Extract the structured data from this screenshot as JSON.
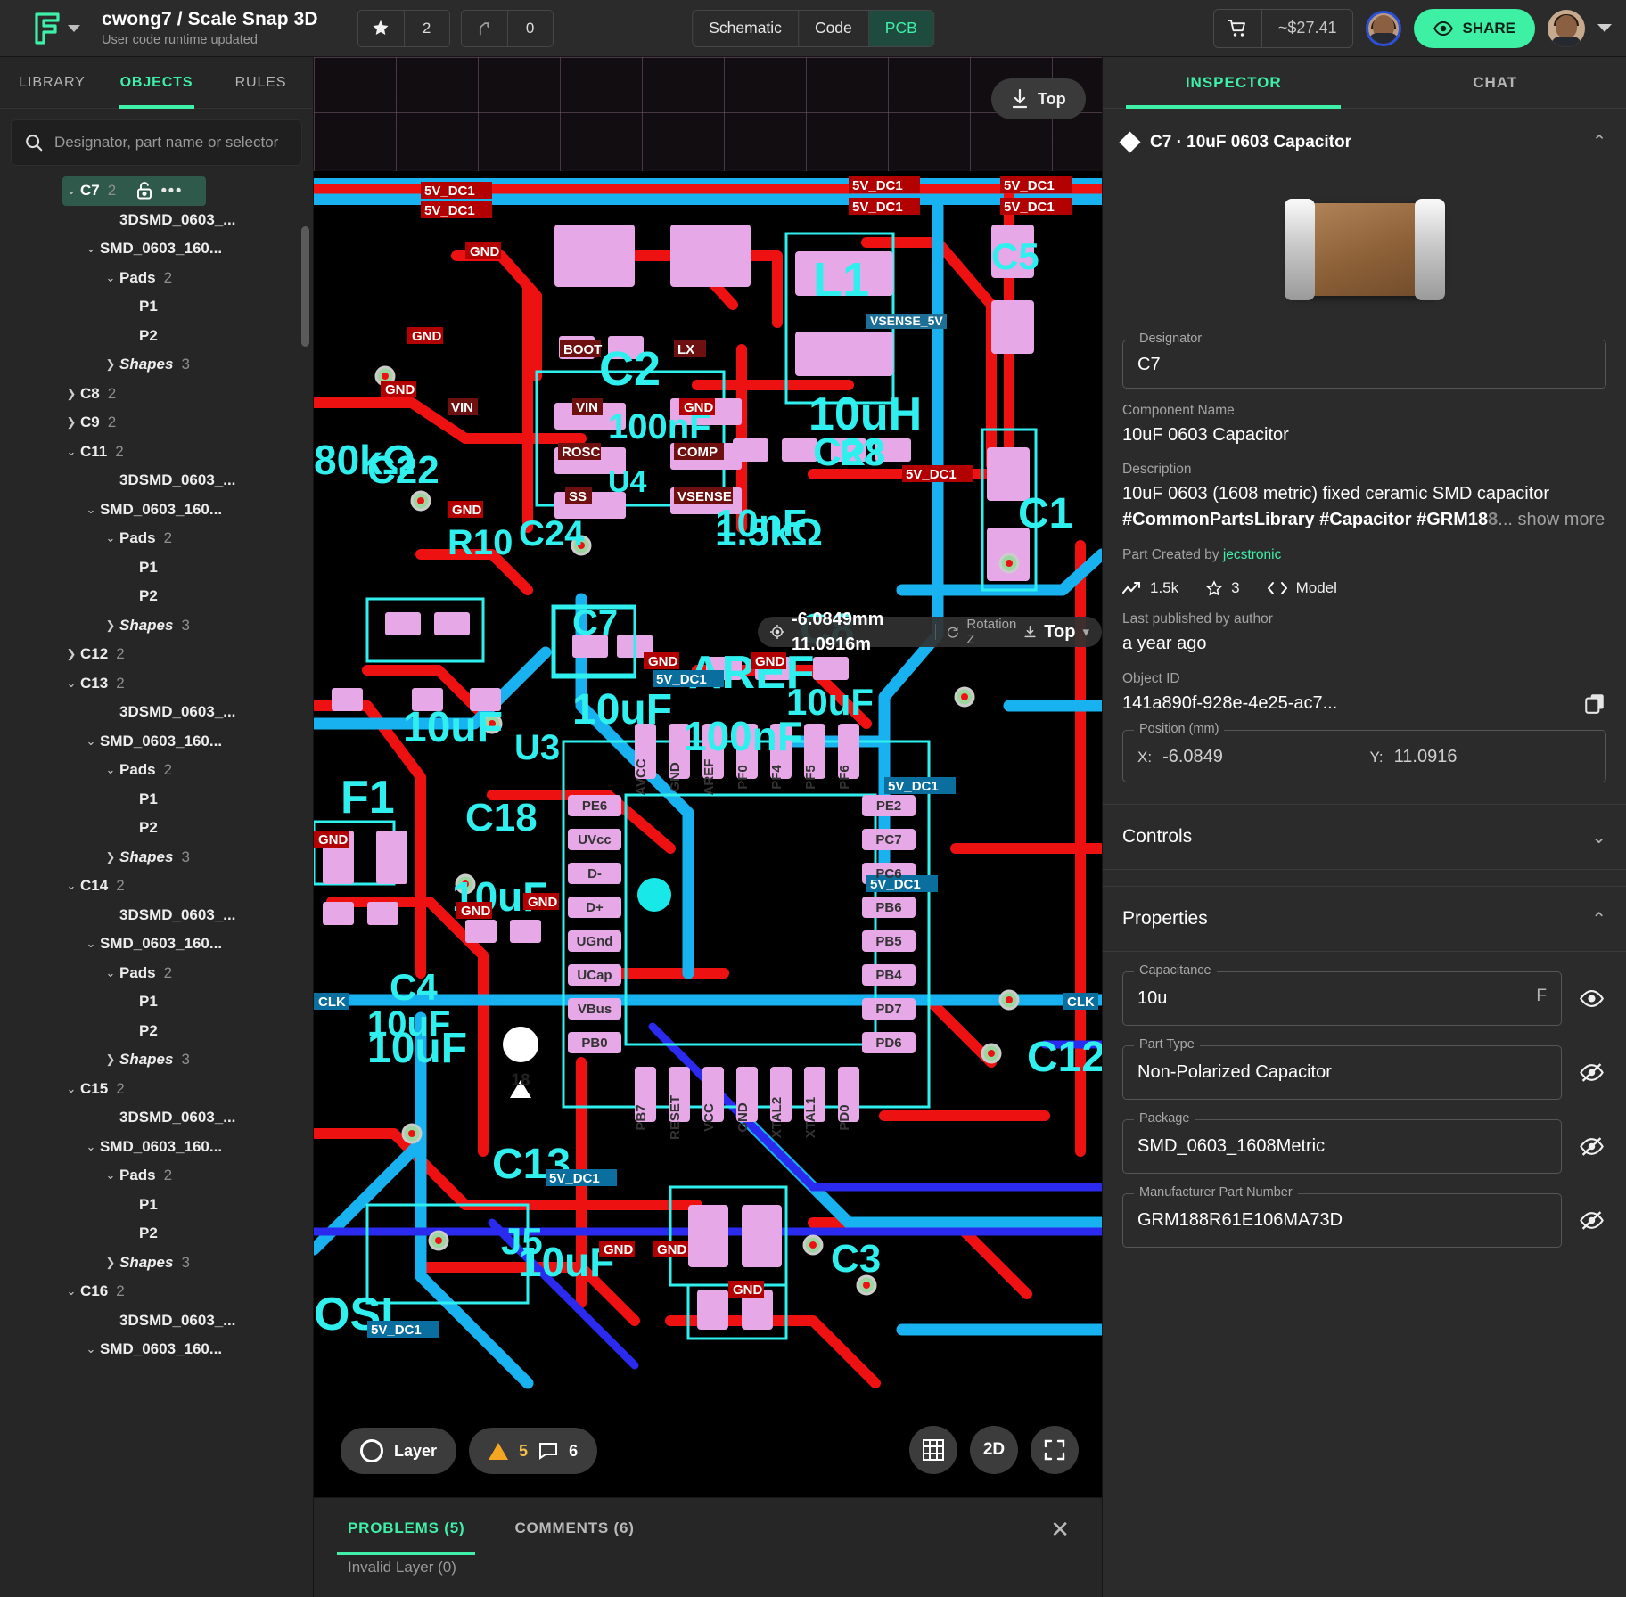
{
  "header": {
    "logo_icon": "flux-logo-icon",
    "project_owner_title": "cwong7 / Scale Snap 3D",
    "project_subtitle": "User code runtime updated",
    "star_icon": "star-icon",
    "star_count": "2",
    "fork_icon": "fork-icon",
    "fork_count": "0",
    "tabs": [
      {
        "label": "Schematic",
        "active": false
      },
      {
        "label": "Code",
        "active": false
      },
      {
        "label": "PCB",
        "active": true
      }
    ],
    "cart_icon": "shopping-cart-icon",
    "cart_price": "~$27.41",
    "collaborator_avatar": "collaborator-avatar",
    "share_icon": "eye-icon",
    "share_label": "SHARE",
    "user_avatar": "user-avatar",
    "user_caret_icon": "chevron-down-icon"
  },
  "left_panel": {
    "tabs": [
      {
        "label": "LIBRARY",
        "active": false
      },
      {
        "label": "OBJECTS",
        "active": true
      },
      {
        "label": "RULES",
        "active": false
      }
    ],
    "search": {
      "icon": "search-icon",
      "placeholder": "Designator, part name or selector",
      "value": ""
    },
    "tree": [
      {
        "indent": 1,
        "chev": "down",
        "label": "C7",
        "count": "2",
        "selected": true,
        "lock_icon": "unlock-icon",
        "more_icon": "more-horizontal-icon"
      },
      {
        "indent": 3,
        "chev": "none",
        "label": "3DSMD_0603_...",
        "count": ""
      },
      {
        "indent": 2,
        "chev": "down",
        "label": "SMD_0603_160...",
        "count": ""
      },
      {
        "indent": 3,
        "chev": "down",
        "label": "Pads",
        "count": "2"
      },
      {
        "indent": 4,
        "chev": "none",
        "label": "P1",
        "count": ""
      },
      {
        "indent": 4,
        "chev": "none",
        "label": "P2",
        "count": ""
      },
      {
        "indent": 3,
        "chev": "right",
        "label": "Shapes",
        "count": "3",
        "italic": true
      },
      {
        "indent": 1,
        "chev": "right",
        "label": "C8",
        "count": "2"
      },
      {
        "indent": 1,
        "chev": "right",
        "label": "C9",
        "count": "2"
      },
      {
        "indent": 1,
        "chev": "down",
        "label": "C11",
        "count": "2"
      },
      {
        "indent": 3,
        "chev": "none",
        "label": "3DSMD_0603_...",
        "count": ""
      },
      {
        "indent": 2,
        "chev": "down",
        "label": "SMD_0603_160...",
        "count": ""
      },
      {
        "indent": 3,
        "chev": "down",
        "label": "Pads",
        "count": "2"
      },
      {
        "indent": 4,
        "chev": "none",
        "label": "P1",
        "count": ""
      },
      {
        "indent": 4,
        "chev": "none",
        "label": "P2",
        "count": ""
      },
      {
        "indent": 3,
        "chev": "right",
        "label": "Shapes",
        "count": "3",
        "italic": true
      },
      {
        "indent": 1,
        "chev": "right",
        "label": "C12",
        "count": "2"
      },
      {
        "indent": 1,
        "chev": "down",
        "label": "C13",
        "count": "2"
      },
      {
        "indent": 3,
        "chev": "none",
        "label": "3DSMD_0603_...",
        "count": ""
      },
      {
        "indent": 2,
        "chev": "down",
        "label": "SMD_0603_160...",
        "count": ""
      },
      {
        "indent": 3,
        "chev": "down",
        "label": "Pads",
        "count": "2"
      },
      {
        "indent": 4,
        "chev": "none",
        "label": "P1",
        "count": ""
      },
      {
        "indent": 4,
        "chev": "none",
        "label": "P2",
        "count": ""
      },
      {
        "indent": 3,
        "chev": "right",
        "label": "Shapes",
        "count": "3",
        "italic": true
      },
      {
        "indent": 1,
        "chev": "down",
        "label": "C14",
        "count": "2"
      },
      {
        "indent": 3,
        "chev": "none",
        "label": "3DSMD_0603_...",
        "count": ""
      },
      {
        "indent": 2,
        "chev": "down",
        "label": "SMD_0603_160...",
        "count": ""
      },
      {
        "indent": 3,
        "chev": "down",
        "label": "Pads",
        "count": "2"
      },
      {
        "indent": 4,
        "chev": "none",
        "label": "P1",
        "count": ""
      },
      {
        "indent": 4,
        "chev": "none",
        "label": "P2",
        "count": ""
      },
      {
        "indent": 3,
        "chev": "right",
        "label": "Shapes",
        "count": "3",
        "italic": true
      },
      {
        "indent": 1,
        "chev": "down",
        "label": "C15",
        "count": "2"
      },
      {
        "indent": 3,
        "chev": "none",
        "label": "3DSMD_0603_...",
        "count": ""
      },
      {
        "indent": 2,
        "chev": "down",
        "label": "SMD_0603_160...",
        "count": ""
      },
      {
        "indent": 3,
        "chev": "down",
        "label": "Pads",
        "count": "2"
      },
      {
        "indent": 4,
        "chev": "none",
        "label": "P1",
        "count": ""
      },
      {
        "indent": 4,
        "chev": "none",
        "label": "P2",
        "count": ""
      },
      {
        "indent": 3,
        "chev": "right",
        "label": "Shapes",
        "count": "3",
        "italic": true
      },
      {
        "indent": 1,
        "chev": "down",
        "label": "C16",
        "count": "2"
      },
      {
        "indent": 3,
        "chev": "none",
        "label": "3DSMD_0603_...",
        "count": ""
      },
      {
        "indent": 2,
        "chev": "down",
        "label": "SMD_0603_160...",
        "count": ""
      }
    ]
  },
  "canvas": {
    "view_pill": {
      "icon": "download-top-icon",
      "label": "Top"
    },
    "position_pill": {
      "target_icon": "crosshair-icon",
      "coords": "-6.0849mm 11.0916m",
      "rotation_icon": "rotate-icon",
      "rotation_label": "Rotation Z",
      "layer_icon": "layer-top-icon",
      "layer_label": "Top",
      "caret_icon": "chevron-down-icon"
    },
    "layer_button": {
      "icon": "circle-icon",
      "label": "Layer"
    },
    "status_chip": {
      "warn_icon": "warning-triangle-icon",
      "warn_count": "5",
      "comment_icon": "comment-icon",
      "comment_count": "6"
    },
    "grid_button": "grid-icon",
    "dim_button": "2D",
    "fullscreen_button": "fullscreen-icon"
  },
  "dock": {
    "tabs": [
      {
        "label": "PROBLEMS (5)",
        "active": true
      },
      {
        "label": "COMMENTS (6)",
        "active": false
      }
    ],
    "close_icon": "close-icon",
    "first_row": "Invalid Layer (0)"
  },
  "inspector": {
    "tabs": [
      {
        "label": "INSPECTOR",
        "active": true
      },
      {
        "label": "CHAT",
        "active": false
      }
    ],
    "header_icon": "diamond-icon",
    "header_title": "C7 · 10uF 0603 Capacitor",
    "collapse_icon": "chevron-up-icon",
    "preview_image": "capacitor-photo",
    "designator_label": "Designator",
    "designator_value": "C7",
    "component_name_label": "Component Name",
    "component_name_value": "10uF 0603 Capacitor",
    "description_label": "Description",
    "description_text": "10uF 0603 (1608 metric) fixed ceramic SMD capacitor ",
    "description_tags": "#CommonPartsLibrary #Capacitor #GRM18",
    "description_truncated": "8",
    "show_more": "... show more",
    "created_by_label": "Part Created by ",
    "created_by_author": "jecstronic",
    "stats": [
      {
        "icon": "trend-icon",
        "value": "1.5k"
      },
      {
        "icon": "star-outline-icon",
        "value": "3"
      },
      {
        "icon": "code-icon",
        "value": "Model"
      }
    ],
    "published_label": "Last published by author",
    "published_value": "a year ago",
    "object_id_label": "Object ID",
    "object_id_value": "141a890f-928e-4e25-ac7...",
    "copy_icon": "copy-icon",
    "position_label": "Position (mm)",
    "position_x_label": "X:",
    "position_x_value": "-6.0849",
    "position_y_label": "Y:",
    "position_y_value": "11.0916",
    "controls_section": "Controls",
    "controls_chevron": "chevron-down-icon",
    "properties_section": "Properties",
    "properties_chevron": "chevron-up-icon",
    "properties": [
      {
        "label": "Capacitance",
        "value": "10u",
        "unit": "F",
        "eye": "eye-visible-icon"
      },
      {
        "label": "Part Type",
        "value": "Non-Polarized Capacitor",
        "unit": "",
        "eye": "eye-hidden-icon"
      },
      {
        "label": "Package",
        "value": "SMD_0603_1608Metric",
        "unit": "",
        "eye": "eye-hidden-icon"
      },
      {
        "label": "Manufacturer Part Number",
        "value": "GRM188R61E106MA73D",
        "unit": "",
        "eye": "eye-hidden-icon"
      }
    ]
  },
  "colors": {
    "accent": "#3ef0a8",
    "panel": "#2b2b2b",
    "left_panel": "#262626",
    "selected_row": "#2f5a4b",
    "copper_red": "#ee1111",
    "copper_blue": "#18b2f0",
    "silk_cyan": "#2ff0ee",
    "pad_pink": "#e7a8e7"
  }
}
